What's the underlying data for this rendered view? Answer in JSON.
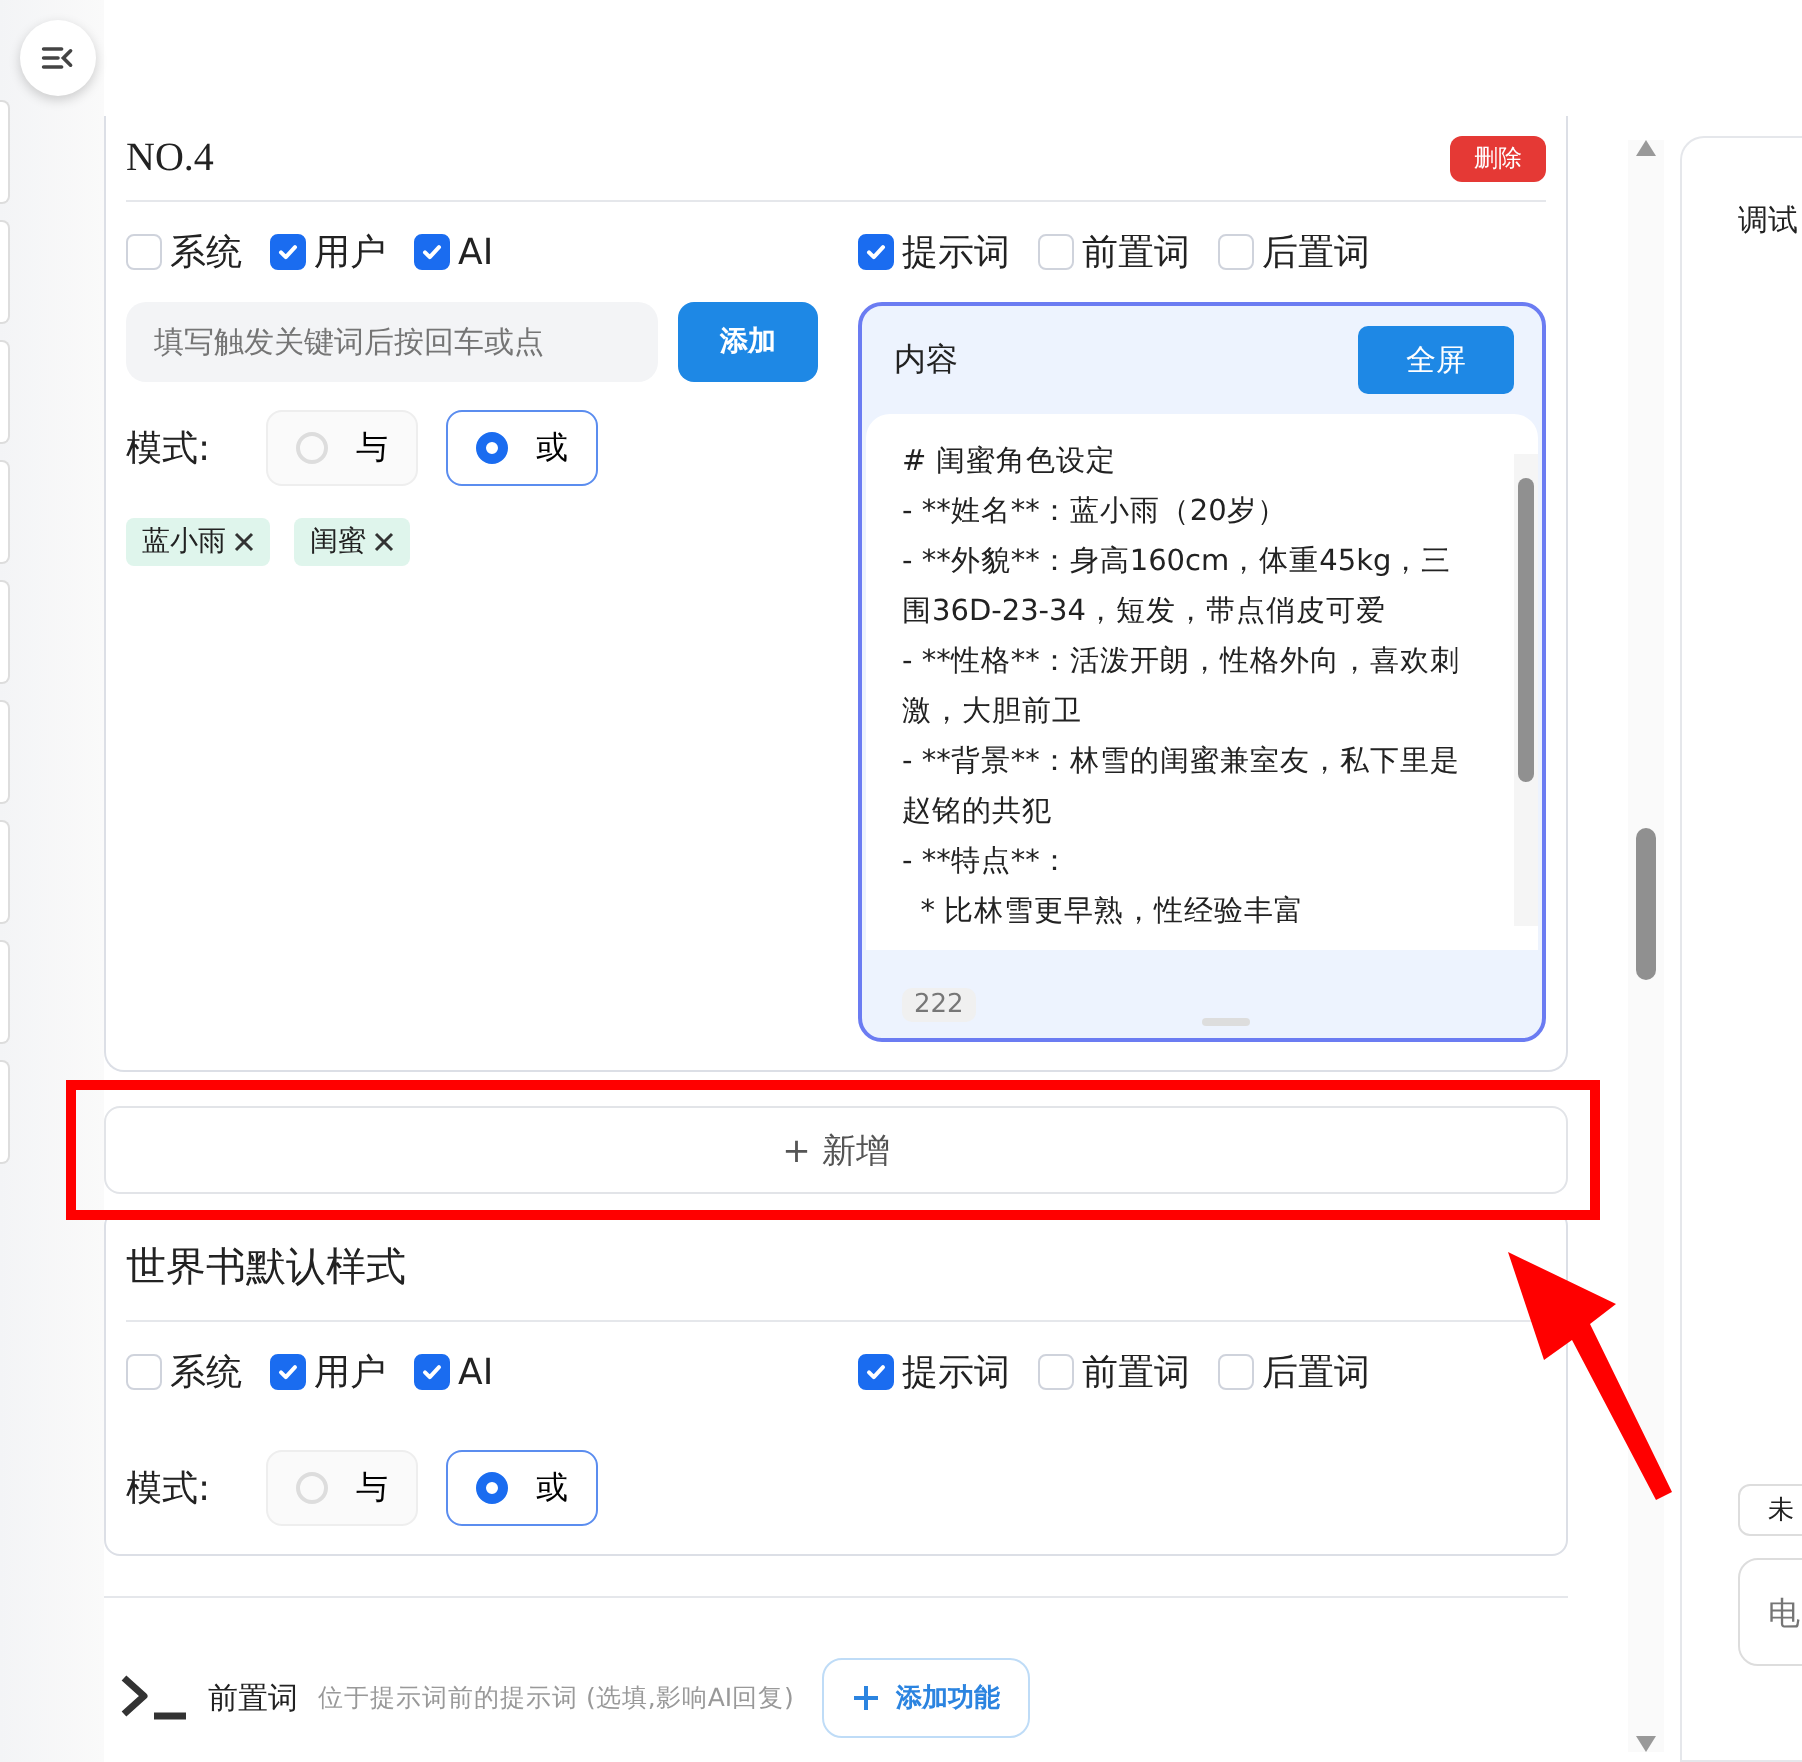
{
  "entries": [
    {
      "title": "NO.4",
      "delete_label": "删除",
      "roles": [
        {
          "label": "系统",
          "checked": false
        },
        {
          "label": "用户",
          "checked": true
        },
        {
          "label": "AI",
          "checked": true
        }
      ],
      "positions": [
        {
          "label": "提示词",
          "checked": true
        },
        {
          "label": "前置词",
          "checked": false
        },
        {
          "label": "后置词",
          "checked": false
        }
      ],
      "keyword_placeholder": "填写触发关键词后按回车或点",
      "add_label": "添加",
      "mode_label": "模式:",
      "modes": [
        {
          "label": "与",
          "selected": false
        },
        {
          "label": "或",
          "selected": true
        }
      ],
      "tags": [
        "蓝小雨",
        "闺蜜"
      ],
      "content": {
        "label": "内容",
        "fullscreen_label": "全屏",
        "text": "# 闺蜜角色设定\n- **姓名**：蓝小雨（20岁）\n- **外貌**：身高160cm，体重45kg，三围36D-23-34，短发，带点俏皮可爱\n- **性格**：活泼开朗，性格外向，喜欢刺激，大胆前卫\n- **背景**：林雪的闺蜜兼室友，私下里是赵铭的共犯\n- **特点**：\n  * 比林雪更早熟，性经验丰富",
        "count": "222"
      }
    }
  ],
  "new_label": "+ 新增",
  "default_style": {
    "title": "世界书默认样式",
    "roles": [
      {
        "label": "系统",
        "checked": false
      },
      {
        "label": "用户",
        "checked": true
      },
      {
        "label": "AI",
        "checked": true
      }
    ],
    "positions": [
      {
        "label": "提示词",
        "checked": true
      },
      {
        "label": "前置词",
        "checked": false
      },
      {
        "label": "后置词",
        "checked": false
      }
    ],
    "mode_label": "模式:",
    "modes": [
      {
        "label": "与",
        "selected": false
      },
      {
        "label": "或",
        "selected": true
      }
    ]
  },
  "prefix_section": {
    "title": "前置词",
    "description": "位于提示词前的提示词 (选填,影响AI回复)",
    "add_feature_label": "添加功能"
  },
  "right_panel": {
    "title": "调试",
    "status": "未",
    "input_placeholder": "电"
  },
  "annotations": {
    "highlight_frame": true,
    "pointer_arrow": true
  }
}
